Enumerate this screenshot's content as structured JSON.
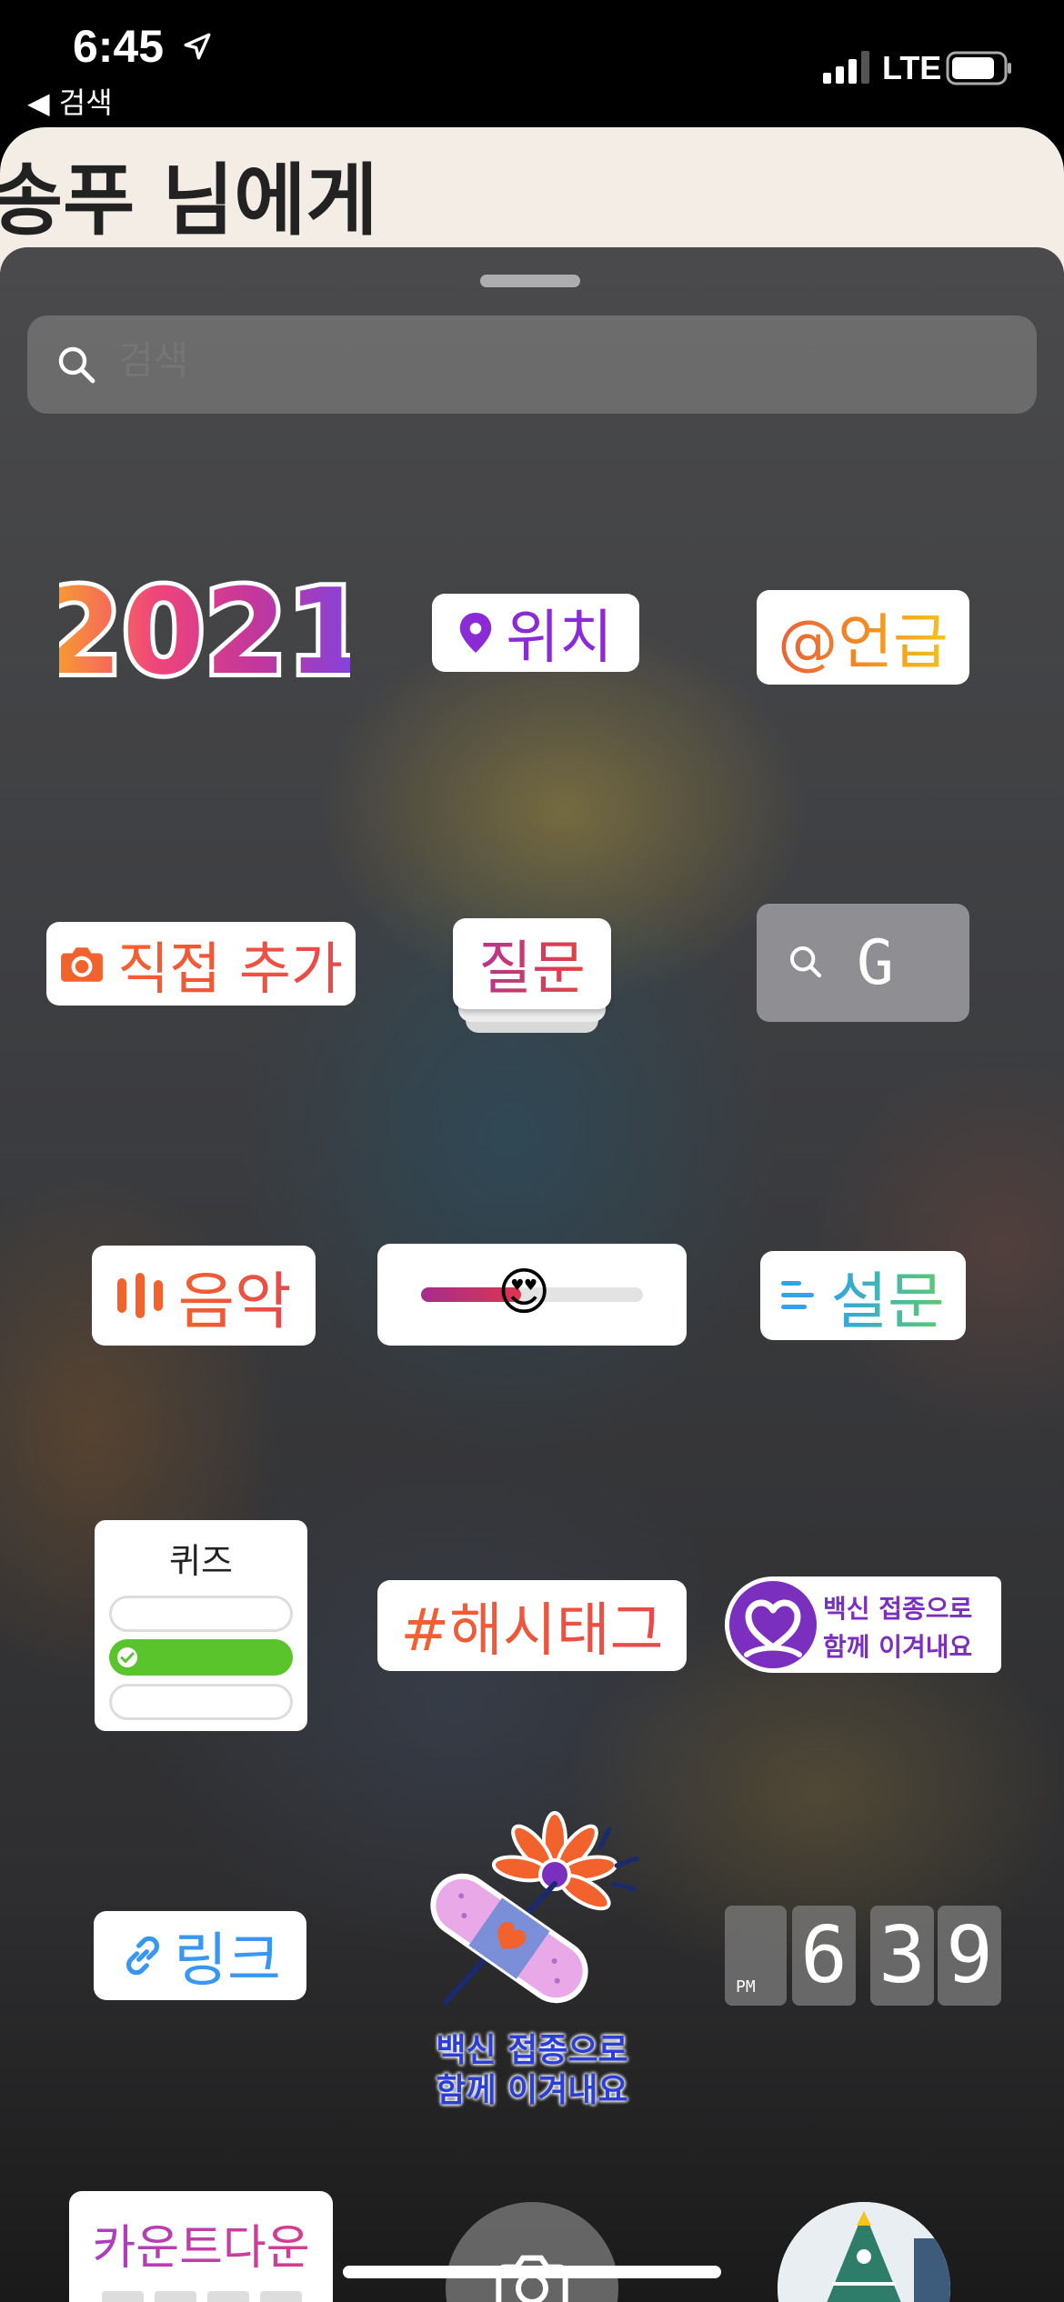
{
  "status_bar": {
    "time": "6:45",
    "back_label": "◀ 검색",
    "network": "LTE",
    "location_icon": "location-arrow-icon",
    "signal_icon": "cellular-signal-icon",
    "battery_icon": "battery-icon"
  },
  "background_card": {
    "title": "송푸 님에게"
  },
  "sheet": {
    "search_placeholder": "검색",
    "search_icon": "search-icon"
  },
  "stickers": {
    "year": "2021",
    "location": "위치",
    "mention": "@언급",
    "add_yours": "직접 추가",
    "questions": "질문",
    "gif_letter": "G",
    "music": "음악",
    "slider_emoji": "😍",
    "poll": "설문",
    "quiz": "퀴즈",
    "hashtag": "#해시태그",
    "vaccine_badge_line1": "백신 접종으로",
    "vaccine_badge_line2": "함께 이겨내요",
    "vaccine_art_line1": "백신 접종으로",
    "vaccine_art_line2": "함께 이겨내요",
    "link": "링크",
    "clock_ampm": "PM",
    "clock_digits": [
      "6",
      "3",
      "9"
    ],
    "countdown": "카운트다운"
  },
  "colors": {
    "sheet_bg": "#3c3d40",
    "accent_purple": "#8a3ab9",
    "accent_pink": "#d62976",
    "accent_orange": "#fa7e1e",
    "quiz_green": "#5ac42c",
    "link_blue": "#3897f0",
    "vaccine_purple": "#7b2fbf"
  }
}
